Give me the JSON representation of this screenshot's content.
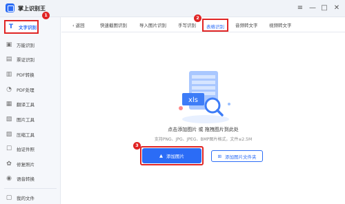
{
  "app": {
    "title": "掌上识别王"
  },
  "window": {
    "controls": [
      "≡",
      "—",
      "□",
      "✕"
    ]
  },
  "sidebar": {
    "items": [
      {
        "label": "文字识别",
        "icon": "text-recognition-icon",
        "glyph": "T"
      },
      {
        "label": "万能识别",
        "icon": "universal-scan-icon",
        "glyph": "▣"
      },
      {
        "label": "票证识别",
        "icon": "ticket-icon",
        "glyph": "▤"
      },
      {
        "label": "PDF转换",
        "icon": "pdf-convert-icon",
        "glyph": "▥"
      },
      {
        "label": "PDF处理",
        "icon": "pdf-process-icon",
        "glyph": "◔"
      },
      {
        "label": "翻译工具",
        "icon": "translate-icon",
        "glyph": "▦"
      },
      {
        "label": "图片工具",
        "icon": "image-tools-icon",
        "glyph": "▧"
      },
      {
        "label": "压缩工具",
        "icon": "compress-icon",
        "glyph": "▨"
      },
      {
        "label": "拍证件照",
        "icon": "id-photo-icon",
        "glyph": "☐"
      },
      {
        "label": "修复照片",
        "icon": "photo-repair-icon",
        "glyph": "✿"
      },
      {
        "label": "语音转换",
        "icon": "voice-convert-icon",
        "glyph": "◉"
      }
    ],
    "footer": {
      "label": "我的文件",
      "icon": "my-files-icon",
      "glyph": "▢"
    }
  },
  "tabs": {
    "back_label": "返回",
    "items": [
      "快速截图识别",
      "导入图片识别",
      "手写识别",
      "表格识别",
      "音频转文字",
      "视频转文字"
    ]
  },
  "badges": [
    "1",
    "2",
    "3"
  ],
  "main": {
    "illustration_text": "xls",
    "drop_text": "点击添加图片 或 拖拽图片到此处",
    "formats_text": "支持PNG、JPG、JPEG、BMP图片格式，文件≤2.5M",
    "add_image_label": "添加图片",
    "add_folder_label": "添加图片文件夹"
  },
  "colors": {
    "accent": "#2b6cf6",
    "highlight": "#e02424"
  }
}
